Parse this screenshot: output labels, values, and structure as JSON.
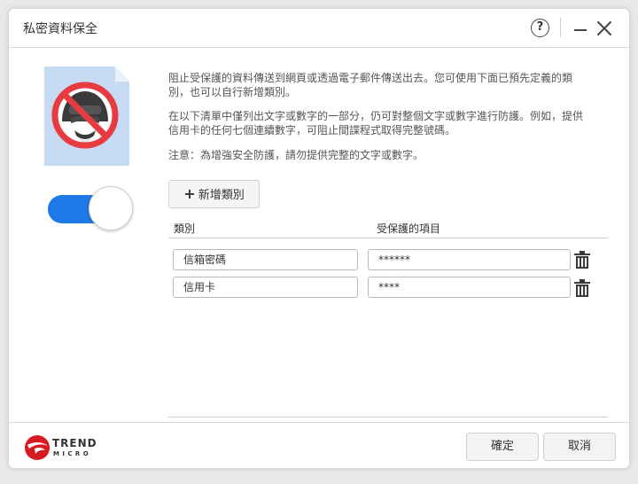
{
  "window": {
    "title": "私密資料保全"
  },
  "titlebar": {
    "help_label": "?"
  },
  "toggle": {
    "state": "on",
    "accent_color": "#1e78e6"
  },
  "description": {
    "paragraph1_line1": "阻止受保護的資料傳送到網頁或透過電子郵件傳送出去。您可使用下面已預先定義的類",
    "paragraph1_line2": "別，也可以自行新增類別。",
    "paragraph2_line1": "在以下清單中僅列出文字或數字的一部分，仍可對整個文字或數字進行防護。例如，提供",
    "paragraph2_line2": "信用卡的任何七個連續數字，可阻止間諜程式取得完整號碼。",
    "note": "注意：為增強安全防護，請勿提供完整的文字或數字。"
  },
  "add_button": {
    "label": "新增類別",
    "icon": "plus-icon"
  },
  "table": {
    "headers": {
      "category": "類別",
      "protected_item": "受保護的項目"
    },
    "rows": [
      {
        "category": "信箱密碼",
        "value": "******"
      },
      {
        "category": "信用卡",
        "value": "****"
      }
    ]
  },
  "footer": {
    "logo_line1": "TREND",
    "logo_line2": "MICRO",
    "ok_label": "確定",
    "cancel_label": "取消"
  }
}
